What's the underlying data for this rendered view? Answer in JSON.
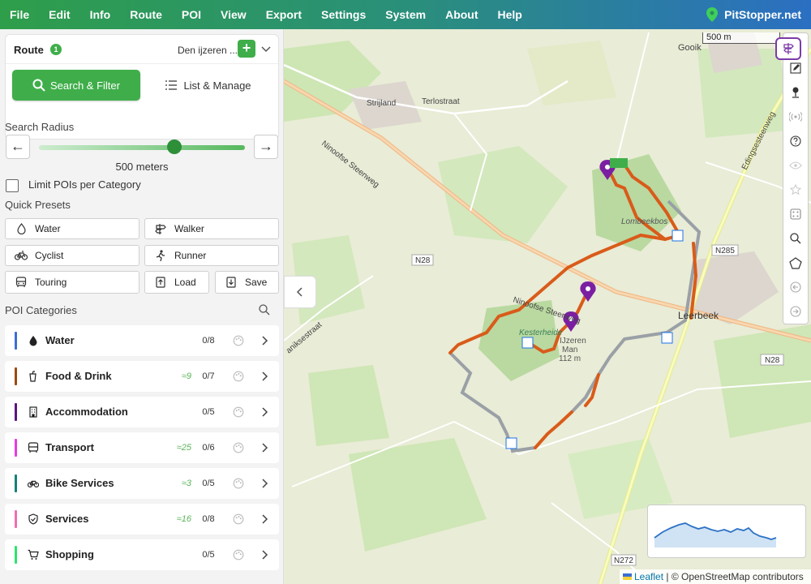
{
  "menu": {
    "items": [
      "File",
      "Edit",
      "Info",
      "Route",
      "POI",
      "View",
      "Export",
      "Settings",
      "System",
      "About",
      "Help"
    ],
    "brand": "PitStopper.net"
  },
  "route": {
    "label": "Route",
    "count": "1",
    "name": "Den ijzeren ...",
    "add": "+"
  },
  "tabs": {
    "search": "Search & Filter",
    "list": "List & Manage"
  },
  "search_radius": {
    "label": "Search Radius",
    "value": "500 meters",
    "level": 0.66,
    "left": "←",
    "right": "→"
  },
  "limit": {
    "label": "Limit POIs per Category",
    "checked": false
  },
  "presets": {
    "label": "Quick Presets",
    "water": "Water",
    "walker": "Walker",
    "cyclist": "Cyclist",
    "runner": "Runner",
    "touring": "Touring",
    "load": "Load",
    "save": "Save"
  },
  "poi": {
    "label": "POI Categories",
    "categories": [
      {
        "name": "Water",
        "approx": "",
        "count": "0/8",
        "color": "#3b6fd1"
      },
      {
        "name": "Food & Drink",
        "approx": "≈9",
        "count": "0/7",
        "color": "#9c4a12"
      },
      {
        "name": "Accommodation",
        "approx": "",
        "count": "0/5",
        "color": "#5b1580"
      },
      {
        "name": "Transport",
        "approx": "≈25",
        "count": "0/6",
        "color": "#e83ce0"
      },
      {
        "name": "Bike Services",
        "approx": "≈3",
        "count": "0/5",
        "color": "#158277"
      },
      {
        "name": "Services",
        "approx": "≈16",
        "count": "0/8",
        "color": "#f06fb2"
      },
      {
        "name": "Shopping",
        "approx": "",
        "count": "0/5",
        "color": "#2fe36d"
      }
    ]
  },
  "map": {
    "scale": "500 m",
    "labels": {
      "strijland": "Strijland",
      "terlostraat": "Terlostraat",
      "ninoofse1": "Ninoofse Steenweg",
      "ninoofse2": "Ninoofse Steenweg",
      "edingse": "Edingsesteenweg",
      "lombeekbos": "Lombeekbos",
      "n28a": "N28",
      "n28b": "N28",
      "n285": "N285",
      "n272": "N272",
      "leerbeek": "Leerbeek",
      "kesterheide": "Kesterheide",
      "ijzeren": "IJzeren",
      "man": "Man",
      "elev": "112 m",
      "gooik": "Gooik",
      "aniksestraat": "aniksestraat"
    },
    "attribution": {
      "leaflet": "Leaflet",
      "rest": "| © OpenStreetMap contributors"
    },
    "route_colors": {
      "active": "#d95b1a",
      "inactive": "#9aa0a6"
    }
  }
}
